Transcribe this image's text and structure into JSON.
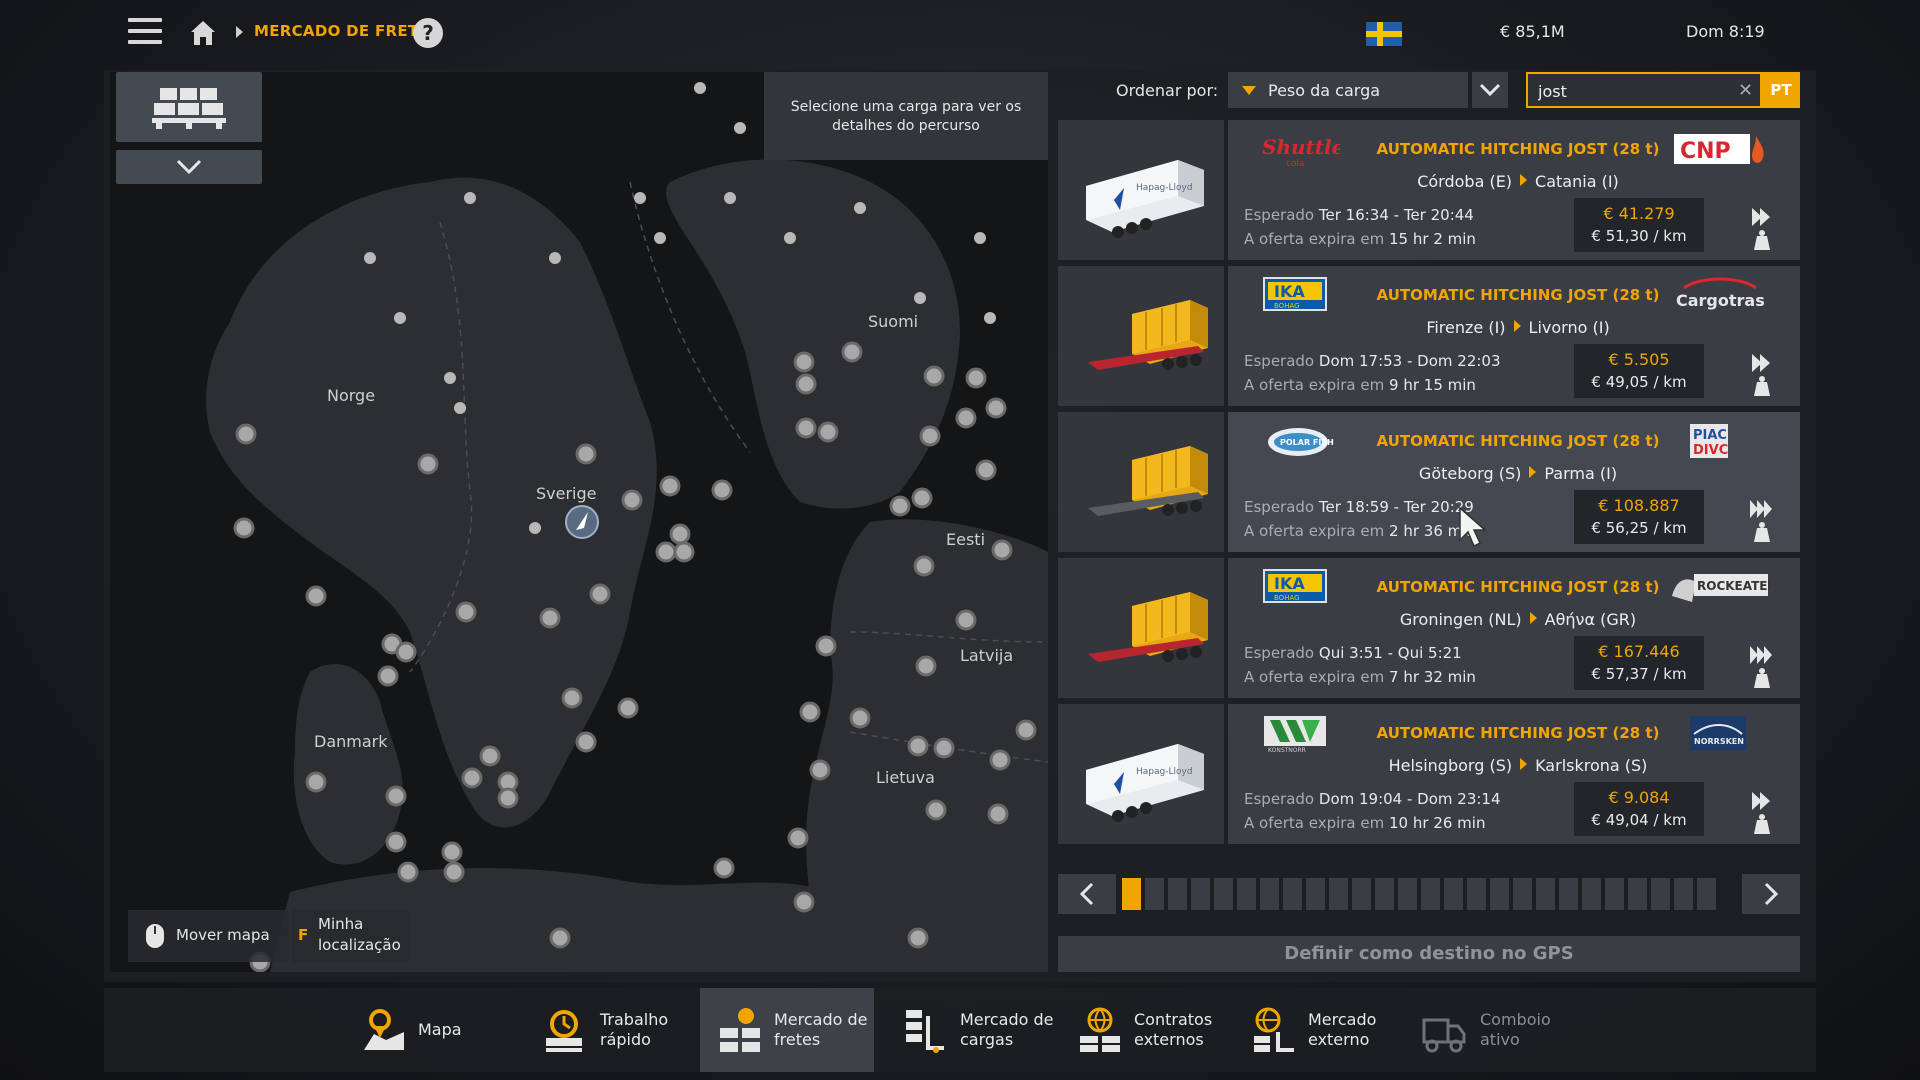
{
  "topbar": {
    "breadcrumb": "MERCADO DE FRETES",
    "help": "?",
    "money": "€ 85,1M",
    "time": "Dom 8:19"
  },
  "map": {
    "hint": "Selecione uma carga para ver os detalhes do percurso",
    "labels": {
      "norge": "Norge",
      "sverige": "Sverige",
      "suomi": "Suomi",
      "eesti": "Eesti",
      "latvija": "Latvija",
      "lietuva": "Lietuva",
      "danmark": "Danmark"
    },
    "move": "Mover mapa",
    "loc_key": "F",
    "loc_line1": "Minha",
    "loc_line2": "localização"
  },
  "sort": {
    "label": "Ordenar por:",
    "value": "Peso da carga"
  },
  "search": {
    "value": "jost",
    "clear": "✕",
    "lang": "PT"
  },
  "jobs": [
    {
      "company": "Shuttle cola",
      "receiver": "CNP",
      "cargo": "AUTOMATIC HITCHING JOST (28 t)",
      "from": "Córdoba (E)",
      "to": "Catania (I)",
      "eta_label": "Esperado",
      "eta": "Ter 16:34 - Ter 20:44",
      "exp_label": "A oferta expira em",
      "exp": "15 hr 2 min",
      "price": "€ 41.279",
      "per_km": "€ 51,30 / km",
      "trailer": "container-white"
    },
    {
      "company": "IKA BOHAG",
      "receiver": "Cargotras",
      "cargo": "AUTOMATIC HITCHING JOST (28 t)",
      "from": "Firenze (I)",
      "to": "Livorno (I)",
      "eta_label": "Esperado",
      "eta": "Dom 17:53 - Dom 22:03",
      "exp_label": "A oferta expira em",
      "exp": "9 hr 15 min",
      "price": "€ 5.505",
      "per_km": "€ 49,05 / km",
      "trailer": "container-yellow"
    },
    {
      "company": "POLAR FISH",
      "receiver": "PIAC DIVC",
      "cargo": "AUTOMATIC HITCHING JOST (28 t)",
      "from": "Göteborg (S)",
      "to": "Parma (I)",
      "eta_label": "Esperado",
      "eta": "Ter 18:59 - Ter 20:29",
      "exp_label": "A oferta expira em",
      "exp": "2 hr 36 min",
      "price": "€ 108.887",
      "per_km": "€ 56,25 / km",
      "trailer": "container-yellow-grey"
    },
    {
      "company": "IKA BOHAG",
      "receiver": "ROCKEATER",
      "cargo": "AUTOMATIC HITCHING JOST (28 t)",
      "from": "Groningen (NL)",
      "to": "Αθήνα (GR)",
      "eta_label": "Esperado",
      "eta": "Qui 3:51 - Qui 5:21",
      "exp_label": "A oferta expira em",
      "exp": "7 hr 32 min",
      "price": "€ 167.446",
      "per_km": "€ 57,37 / km",
      "trailer": "container-yellow"
    },
    {
      "company": "KONSTNORR",
      "receiver": "NORRSKEN",
      "cargo": "AUTOMATIC HITCHING JOST (28 t)",
      "from": "Helsingborg (S)",
      "to": "Karlskrona (S)",
      "eta_label": "Esperado",
      "eta": "Dom 19:04 - Dom 23:14",
      "exp_label": "A oferta expira em",
      "exp": "10 hr 26 min",
      "price": "€ 9.084",
      "per_km": "€ 49,04 / km",
      "trailer": "container-white"
    }
  ],
  "pager": {
    "pages": 26,
    "current": 1
  },
  "gps_button": "Definir como destino no GPS",
  "nav": [
    {
      "l1": "Mapa",
      "l2": ""
    },
    {
      "l1": "Trabalho",
      "l2": "rápido"
    },
    {
      "l1": "Mercado de",
      "l2": "fretes"
    },
    {
      "l1": "Mercado de",
      "l2": "cargas"
    },
    {
      "l1": "Contratos",
      "l2": "externos"
    },
    {
      "l1": "Mercado",
      "l2": "externo"
    },
    {
      "l1": "Comboio",
      "l2": "ativo"
    }
  ],
  "colors": {
    "accent": "#f0a500",
    "card": "#3a3e44",
    "card_selected": "#444951"
  }
}
